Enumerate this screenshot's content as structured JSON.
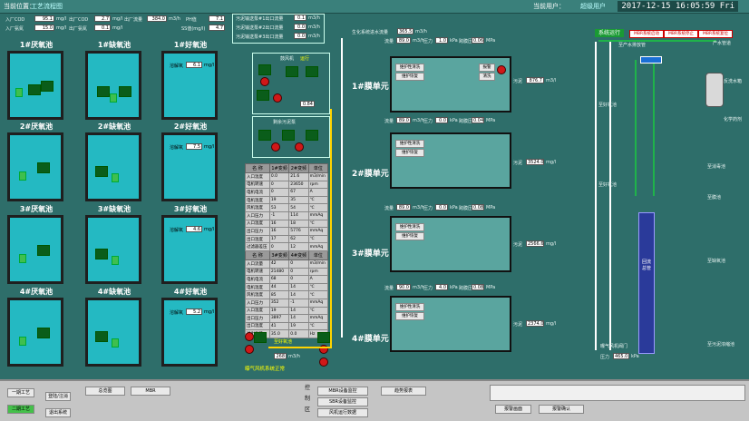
{
  "header": {
    "location_label": "当前位置：",
    "location_value": "工艺流程图",
    "user_label": "当前用户：",
    "user_value": "超级用户",
    "clock": "2017-12-15 16:05:59 Fri"
  },
  "inlet": {
    "rows": [
      {
        "label": "入厂COD",
        "value": "95.1",
        "unit": "mg/l",
        "label2": "出厂COD",
        "value2": "2.7",
        "unit2": "mg/l",
        "label3": "出厂流量",
        "value3": "384.0",
        "unit3": "m3/h",
        "label4": "PH值",
        "value4": "7.1"
      },
      {
        "label": "入厂氨氮",
        "value": "15.0",
        "unit": "mg/l",
        "label2": "出厂氨氮",
        "value2": "0.1",
        "unit2": "mg/l",
        "label4": "SS值(mg/l)",
        "value4": "4.7"
      }
    ],
    "sludge": [
      {
        "label": "污泥输送泵#1出口流量",
        "value": "0.1",
        "unit": "m3/h"
      },
      {
        "label": "污泥输送泵#2出口流量",
        "value": "0.0",
        "unit": "m3/h"
      },
      {
        "label": "污泥输送泵#3出口流量",
        "value": "0.0",
        "unit": "m3/h"
      }
    ]
  },
  "tanks": {
    "rows": [
      {
        "anox1": "1#厌氧池",
        "anox2": "1#缺氧池",
        "oxic": "1#好氧池",
        "do": "6.1"
      },
      {
        "anox1": "2#厌氧池",
        "anox2": "2#缺氧池",
        "oxic": "2#好氧池",
        "do": "7.5"
      },
      {
        "anox1": "3#厌氧池",
        "anox2": "3#缺氧池",
        "oxic": "3#好氧池",
        "do": "4.6"
      },
      {
        "anox1": "4#厌氧池",
        "anox2": "4#缺氧池",
        "oxic": "4#好氧池",
        "do": "5.2"
      }
    ],
    "do_label": "溶解氧",
    "do_unit": "mg/l"
  },
  "blower_panel": {
    "title": "鼓风机",
    "status": "运行",
    "value": "0.84"
  },
  "sludge_panel": {
    "title": "剩余污泥泵"
  },
  "fan_table": {
    "header1": [
      "名 称",
      "1#变频",
      "2#变频",
      "单位"
    ],
    "rows1": [
      [
        "入口温度",
        "0.0",
        "21.6",
        "m3/min"
      ],
      [
        "电机转速",
        "0",
        "23650",
        "rpm"
      ],
      [
        "电机电流",
        "0",
        "67",
        "A"
      ],
      [
        "电机温度",
        "19",
        "35",
        "℃"
      ],
      [
        "风机温度",
        "53",
        "54",
        "℃"
      ],
      [
        "入口压力",
        "-1",
        "114",
        "mmAq"
      ],
      [
        "入口温度",
        "16",
        "18",
        "℃"
      ],
      [
        "出口压力",
        "16",
        "5776",
        "mmAq"
      ],
      [
        "出口温度",
        "17",
        "62",
        "℃"
      ],
      [
        "过滤器差压",
        "0",
        "12",
        "mmAq"
      ]
    ],
    "header2": [
      "名 称",
      "3#变频",
      "4#变频",
      "单位"
    ],
    "rows2": [
      [
        "入口流量",
        "42",
        "0",
        "m3/min"
      ],
      [
        "电机转速",
        "21480",
        "0",
        "rpm"
      ],
      [
        "电机电流",
        "68",
        "0",
        "A"
      ],
      [
        "电机温度",
        "44",
        "14",
        "℃"
      ],
      [
        "风机温度",
        "85",
        "14",
        "℃"
      ],
      [
        "入口压力",
        "352",
        "-1",
        "mmAq"
      ],
      [
        "入口温度",
        "19",
        "14",
        "℃"
      ],
      [
        "出口压力",
        "3897",
        "14",
        "mmAq"
      ],
      [
        "出口温度",
        "41",
        "19",
        "℃"
      ],
      [
        "进出气差",
        "35.0",
        "0.0",
        "Hz"
      ]
    ],
    "footer": "曝气风机系统正常",
    "air_label": "至好氧池",
    "air_flow": "268",
    "air_unit": "m3/h"
  },
  "membrane": {
    "top_flow_label": "生化系统进水流量",
    "top_flow_value": "365.5",
    "top_flow_unit": "m3/h",
    "sys_run": "系统运行",
    "btn_start": "MBR系统启动",
    "btn_stop": "MBR系统停止",
    "btn_reset": "MBR系统复位",
    "units": [
      {
        "name": "1#膜单元",
        "flow": "89.0",
        "press": "1.0",
        "tmp": "0.06",
        "level": "876.7",
        "level_unit": "m3/l"
      },
      {
        "name": "2#膜单元",
        "flow": "89.0",
        "press": "0.0",
        "tmp": "0.04",
        "level": "3524.0",
        "level_unit": "mg/l"
      },
      {
        "name": "3#膜单元",
        "flow": "89.0",
        "press": "0.0",
        "tmp": "0.08",
        "level": "2566.6",
        "level_unit": "mg/l"
      },
      {
        "name": "4#膜单元",
        "flow": "90.0",
        "press": "4.0",
        "tmp": "0.08",
        "level": "2374.0",
        "level_unit": "mg/l"
      }
    ],
    "flow_label": "流量",
    "flow_unit": "m3/h",
    "press_label": "压力",
    "press_unit": "kPa",
    "tmp_label": "跨膜压差",
    "tmp_unit": "MPa",
    "level_label": "污泥",
    "maint_wash": "维护性清洗",
    "maint_recover": "维护恢复",
    "alarm": "报警",
    "clean": "清洗",
    "to_oxic": "至好氧池",
    "to_clear": "至产水排放管",
    "to_prod": "产水管道",
    "to_anoxic_side": "至缺氧池",
    "to_wash": "至消毒池",
    "to_return": "至膜池",
    "to_recycle": "至污泥浓缩池",
    "air_flow_label": "压力",
    "air_flow_value": "465.0",
    "air_flow_unit": "kPa",
    "blower_label": "曝气风机阀门",
    "header_tag": "回流总管",
    "tank_side": "反洗水箱",
    "tank_side2": "化学药剂"
  },
  "bottom": {
    "btn1": "一期工艺",
    "btn2": "二期工艺",
    "btn3": "登陆/注消",
    "btn4": "退出系统",
    "btn5": "总览图",
    "btn6": "MBR",
    "section_label": [
      "控",
      "制",
      "区"
    ],
    "btn7": "MBR设备监控",
    "btn8": "SBR设备监控",
    "btn9": "风机运行数据",
    "btn10": "趋势报表",
    "btn11": "报警画面",
    "btn12": "报警确认"
  },
  "colors": {
    "bg": "#2e6e6a",
    "tank": "#24b9c2",
    "pipe_air": "#ffd400",
    "pipe_water": "#ffffff",
    "pipe_green": "#1fb34a",
    "alarm": "#d01818"
  }
}
